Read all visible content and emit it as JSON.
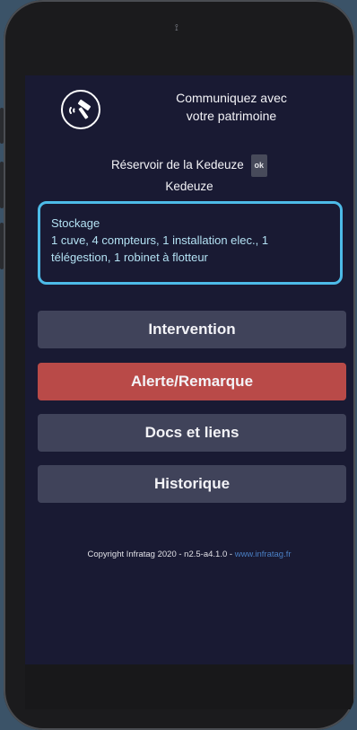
{
  "header": {
    "tagline_line1": "Communiquez avec",
    "tagline_line2": "votre patrimoine"
  },
  "site": {
    "name": "Réservoir de la Kedeuze",
    "badge": "ok",
    "location": "Kedeuze"
  },
  "storage": {
    "title": "Stockage",
    "description": "1 cuve, 4 compteurs, 1 installation elec., 1 télégestion, 1 robinet à flotteur"
  },
  "actions": {
    "intervention": "Intervention",
    "alert": "Alerte/Remarque",
    "docs": "Docs et liens",
    "history": "Historique"
  },
  "footer": {
    "copyright": "Copyright Infratag 2020 - n2.5-a4.1.0 - ",
    "link": "www.infratag.fr"
  },
  "colors": {
    "background": "#191a33",
    "card_border": "#4dbbe8",
    "button": "#40435a",
    "alert_button": "#b94a48"
  }
}
